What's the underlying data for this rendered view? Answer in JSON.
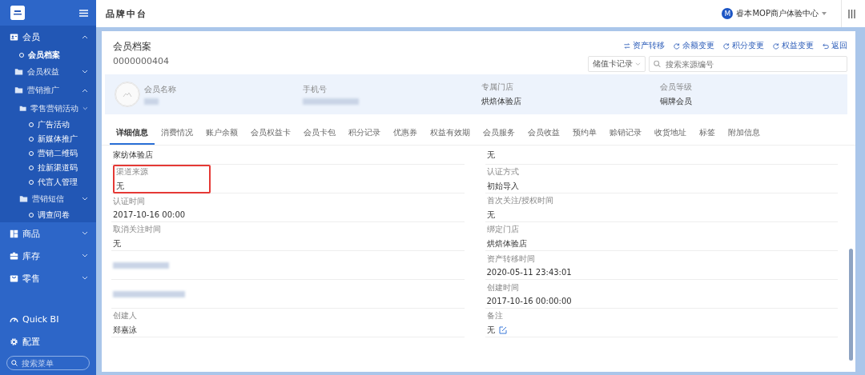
{
  "sidebar": {
    "items": [
      {
        "label": "会员",
        "expanded": true,
        "children": [
          {
            "label": "会员档案",
            "selected": true
          },
          {
            "label": "会员权益",
            "expanded": false
          },
          {
            "label": "营销推广",
            "expanded": true,
            "children": [
              {
                "label": "零售营销活动",
                "expanded": false,
                "children": [
                  {
                    "label": "广告活动",
                    "selected": false
                  },
                  {
                    "label": "新媒体推广",
                    "selected": false
                  },
                  {
                    "label": "营销二维码",
                    "selected": false
                  },
                  {
                    "label": "拉新渠道码",
                    "selected": false
                  },
                  {
                    "label": "代言人管理",
                    "selected": false
                  }
                ]
              },
              {
                "label": "营销短信",
                "expanded": false,
                "children": [
                  {
                    "label": "调查问卷",
                    "selected": false
                  }
                ]
              }
            ]
          }
        ]
      },
      {
        "label": "商品",
        "expanded": false
      },
      {
        "label": "库存",
        "expanded": false
      },
      {
        "label": "零售",
        "expanded": false
      }
    ],
    "footer": [
      {
        "label": "Quick BI"
      },
      {
        "label": "配置"
      }
    ],
    "search": {
      "placeholder": "搜索菜单"
    }
  },
  "topbar": {
    "title": "品牌中台",
    "account_initial": "M",
    "account": "睿本MOP商户体验中心"
  },
  "record": {
    "title": "会员档案",
    "id": "0000000404",
    "actions": [
      {
        "label": "资产转移"
      },
      {
        "label": "余额变更"
      },
      {
        "label": "积分变更"
      },
      {
        "label": "权益变更"
      },
      {
        "label": "返回"
      }
    ],
    "filter": {
      "value": "储值卡记录"
    },
    "search": {
      "placeholder": "搜索来源编号"
    },
    "summary": [
      {
        "label": "会员名称",
        "kind": "redacted"
      },
      {
        "label": "手机号",
        "kind": "redacted"
      },
      {
        "label": "专属门店",
        "value": "烘焙体验店",
        "kind": "text"
      },
      {
        "label": "会员等级",
        "value": "铜牌会员",
        "kind": "text"
      }
    ]
  },
  "tabs": [
    {
      "label": "详细信息",
      "selected": true
    },
    {
      "label": "消费情况",
      "selected": false
    },
    {
      "label": "账户余额",
      "selected": false
    },
    {
      "label": "会员权益卡",
      "selected": false
    },
    {
      "label": "会员卡包",
      "selected": false
    },
    {
      "label": "积分记录",
      "selected": false
    },
    {
      "label": "优惠券",
      "selected": false
    },
    {
      "label": "权益有效期",
      "selected": false
    },
    {
      "label": "会员服务",
      "selected": false
    },
    {
      "label": "会员收益",
      "selected": false
    },
    {
      "label": "预约单",
      "selected": false
    },
    {
      "label": "赊销记录",
      "selected": false
    },
    {
      "label": "收货地址",
      "selected": false
    },
    {
      "label": "标签",
      "selected": false
    },
    {
      "label": "附加信息",
      "selected": false
    }
  ],
  "details": {
    "left": [
      {
        "kind": "text",
        "value": "家纺体验店",
        "highlighted": false
      },
      {
        "kind": "text",
        "label": "渠道来源",
        "value": "无",
        "highlighted": true
      },
      {
        "kind": "text",
        "label": "认证时间",
        "value": "2017-10-16 00:00",
        "highlighted": false
      },
      {
        "kind": "text",
        "label": "取消关注时间",
        "value": "无",
        "highlighted": false
      },
      {
        "kind": "redacted",
        "highlighted": false
      },
      {
        "kind": "redacted",
        "highlighted": false
      },
      {
        "kind": "text",
        "label": "创建人",
        "value": "郑嘉泳",
        "highlighted": false
      }
    ],
    "right": [
      {
        "kind": "text",
        "value": "无",
        "highlighted": false
      },
      {
        "kind": "text",
        "label": "认证方式",
        "value": "初始导入",
        "highlighted": false
      },
      {
        "kind": "text",
        "label": "首次关注/授权时间",
        "value": "无",
        "highlighted": false
      },
      {
        "kind": "text",
        "label": "绑定门店",
        "value": "烘焙体验店",
        "highlighted": false
      },
      {
        "kind": "text",
        "label": "资产转移时间",
        "value": "2020-05-11 23:43:01",
        "highlighted": false
      },
      {
        "kind": "text",
        "label": "创建时间",
        "value": "2017-10-16 00:00:00",
        "highlighted": false
      },
      {
        "kind": "editable",
        "label": "备注",
        "value": "无",
        "highlighted": false
      }
    ]
  }
}
